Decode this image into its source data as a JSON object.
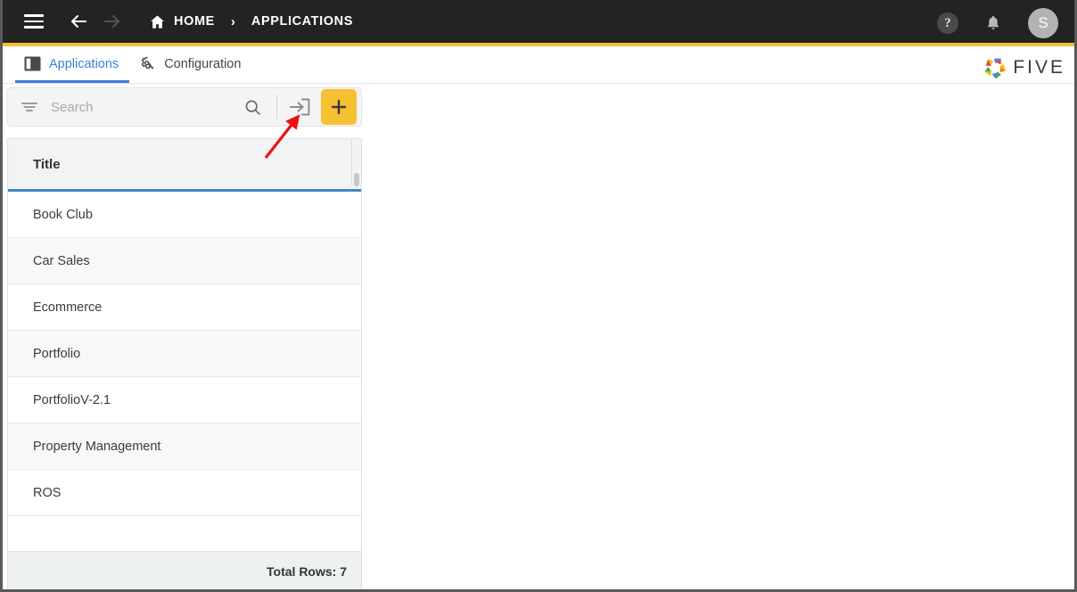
{
  "header": {
    "menu_icon": "hamburger-menu-icon",
    "back_icon": "arrow-left-icon",
    "forward_icon": "arrow-right-icon",
    "home_icon": "home-icon",
    "breadcrumb": {
      "home_label": "HOME",
      "separator": "›",
      "current_label": "APPLICATIONS"
    },
    "help_label": "?",
    "help_icon": "help-circle-icon",
    "notifications_icon": "bell-icon",
    "avatar_initial": "S",
    "accent_color": "#F5C131",
    "background_color": "#232323"
  },
  "tabs": [
    {
      "label": "Applications",
      "icon": "panel-layout-icon",
      "active": true
    },
    {
      "label": "Configuration",
      "icon": "gear-wrench-icon",
      "active": false
    }
  ],
  "brand": {
    "name": "FIVE",
    "logo_icon": "five-pinwheel-logo",
    "logo_colors": [
      "#4285F4",
      "#EA4335",
      "#FBBC05",
      "#34A853",
      "#F57C00"
    ]
  },
  "toolbar": {
    "filter_icon": "filter-icon",
    "search_placeholder": "Search",
    "search_value": "",
    "search_icon": "magnifier-icon",
    "import_icon": "import-arrow-into-box-icon",
    "add_icon": "plus-icon",
    "add_button_color": "#F5C131"
  },
  "grid": {
    "columns": [
      "Title"
    ],
    "header_underline_color": "#4285c5",
    "rows": [
      {
        "title": "Book Club"
      },
      {
        "title": "Car Sales"
      },
      {
        "title": "Ecommerce"
      },
      {
        "title": "Portfolio"
      },
      {
        "title": "PortfolioV-2.1"
      },
      {
        "title": "Property Management"
      },
      {
        "title": "ROS"
      },
      {
        "title": ""
      }
    ],
    "footer_label": "Total Rows: 7"
  },
  "annotation": {
    "arrow_color": "#ee1111",
    "points_to": "import-arrow-into-box-icon"
  }
}
